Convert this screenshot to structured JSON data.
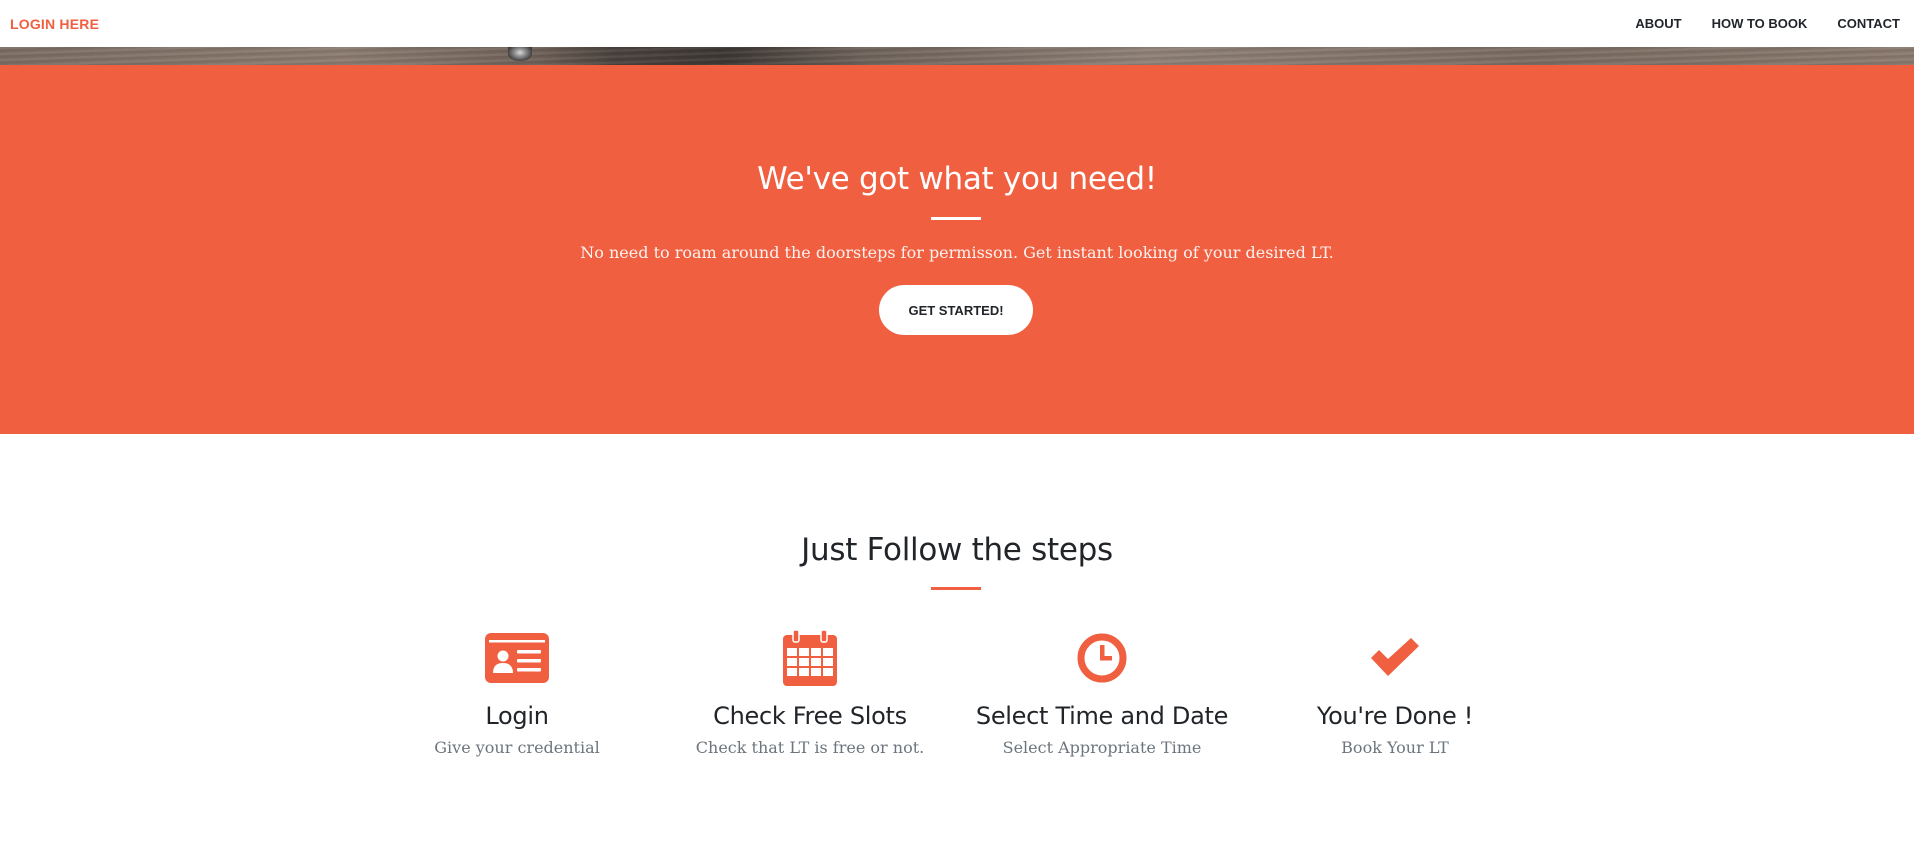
{
  "navbar": {
    "brand": "LOGIN HERE",
    "links": [
      "ABOUT",
      "HOW TO BOOK",
      "CONTACT"
    ]
  },
  "about": {
    "title": "We've got what you need!",
    "text": "No need to roam around the doorsteps for permisson. Get instant looking of your desired LT.",
    "button": "GET STARTED!"
  },
  "services": {
    "title": "Just Follow the steps",
    "items": [
      {
        "icon": "id-card-icon",
        "heading": "Login",
        "desc": "Give your credential"
      },
      {
        "icon": "calendar-icon",
        "heading": "Check Free Slots",
        "desc": "Check that LT is free or not."
      },
      {
        "icon": "clock-icon",
        "heading": "Select Time and Date",
        "desc": "Select Appropriate Time"
      },
      {
        "icon": "checkmark-icon",
        "heading": "You're Done !",
        "desc": "Book Your LT"
      }
    ]
  },
  "colors": {
    "primary": "#f05f40",
    "text": "#212529",
    "muted": "#6c757d"
  }
}
